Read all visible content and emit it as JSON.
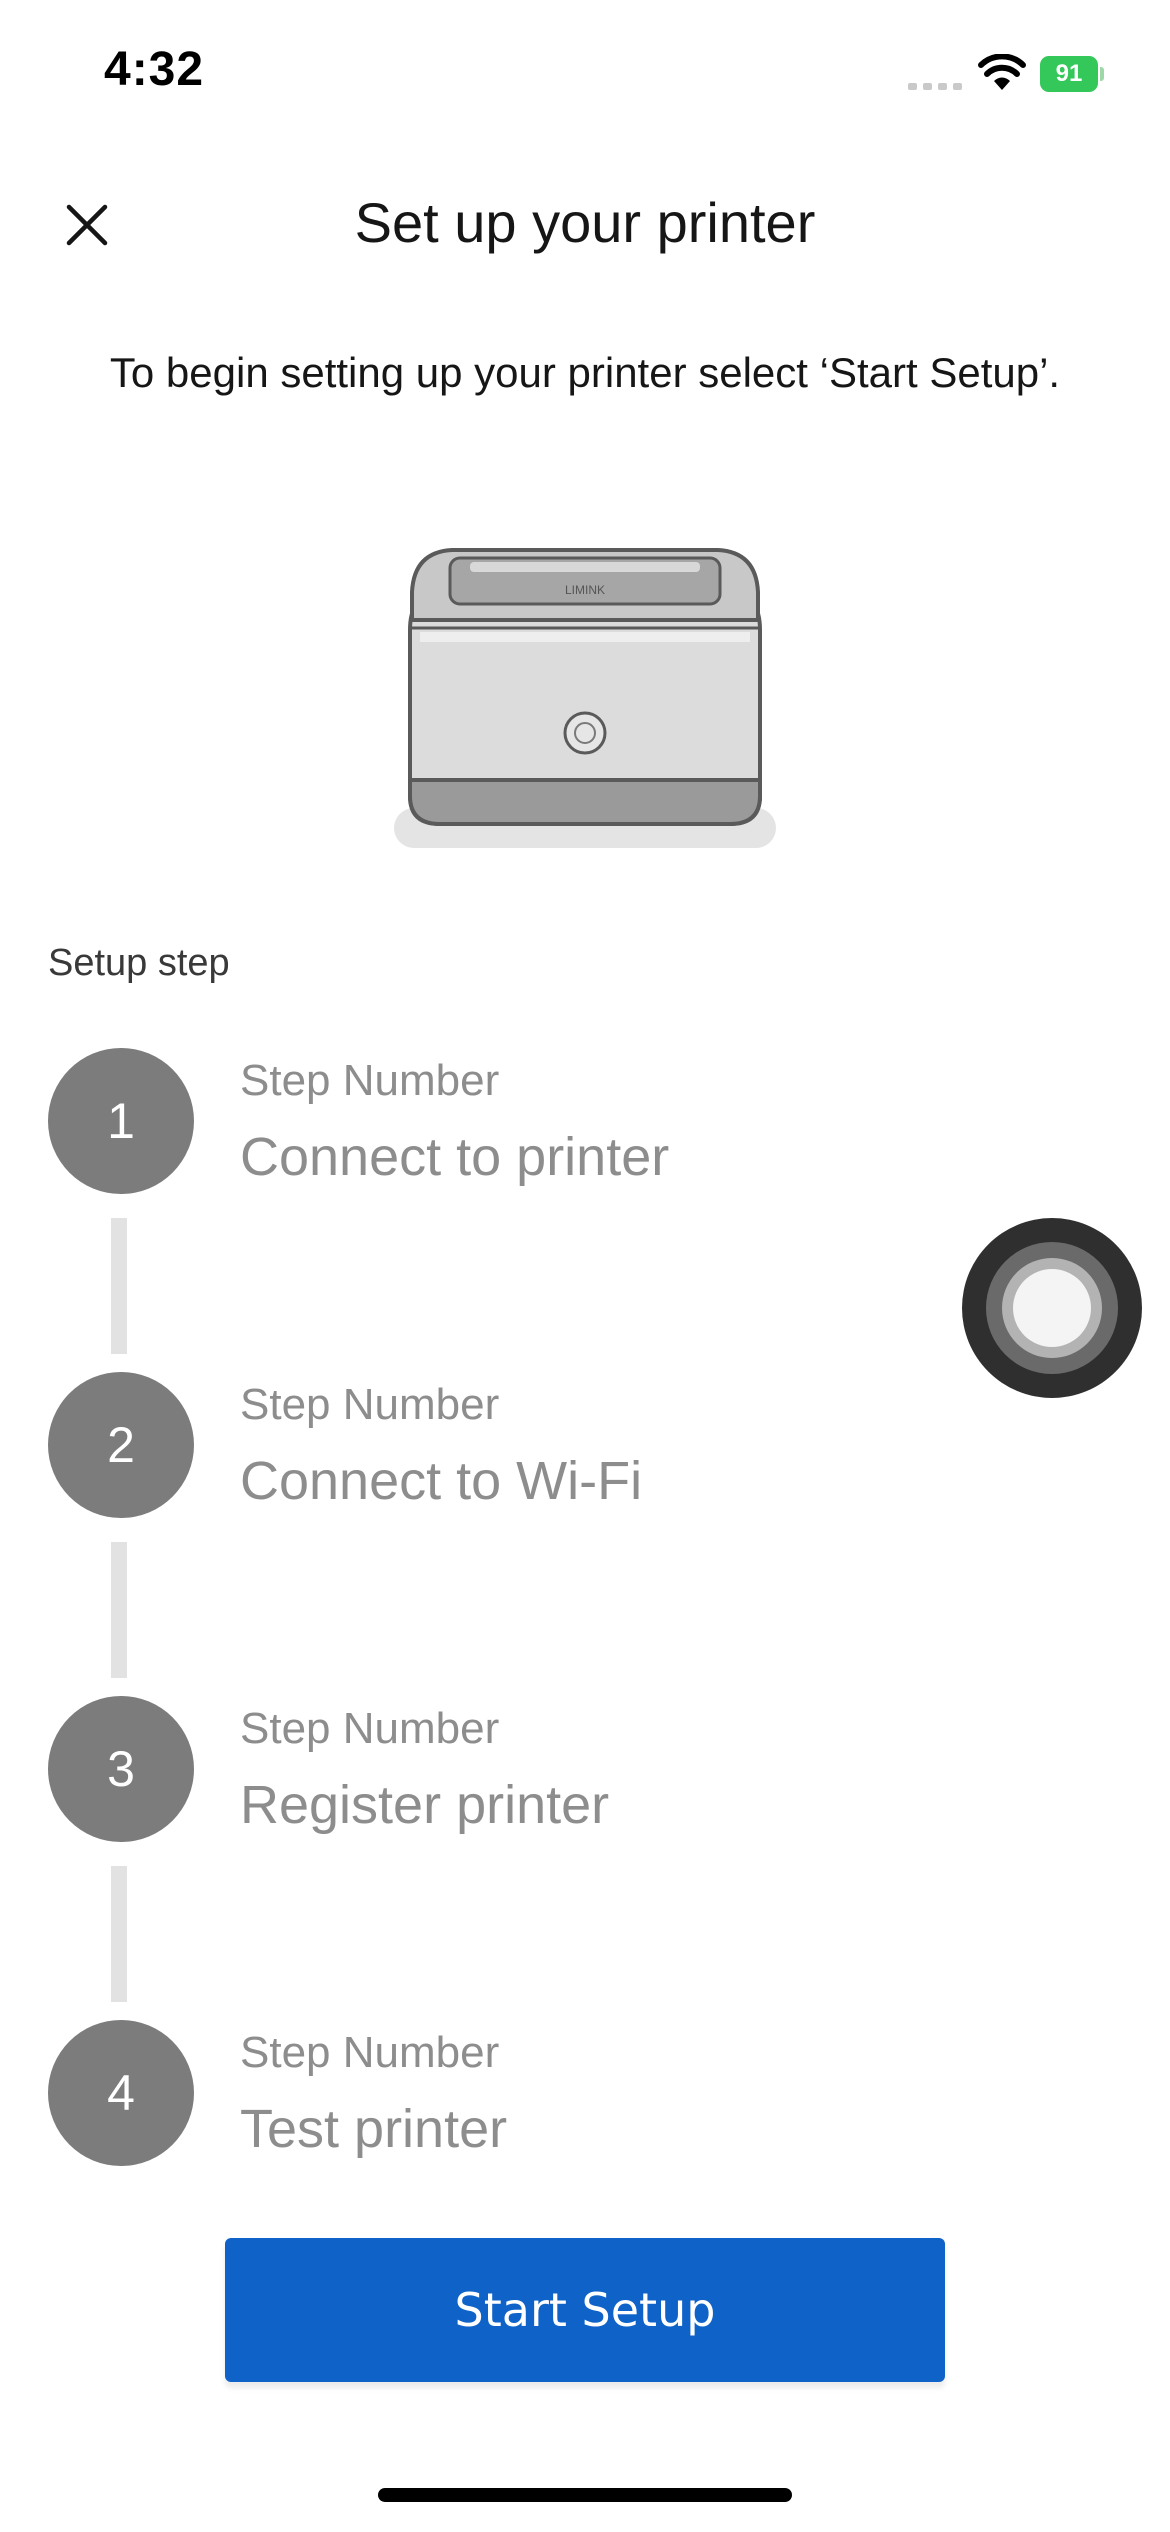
{
  "status_bar": {
    "time": "4:32",
    "battery_level": "91",
    "battery_color": "#34c759"
  },
  "header": {
    "title": "Set up your printer",
    "close_icon": "close-icon"
  },
  "intro": {
    "text": "To begin setting up your printer select ‘Start Setup’."
  },
  "illustration": {
    "icon": "printer-illustration",
    "brand_mark": "LIMINK"
  },
  "setup": {
    "section_label": "Setup step",
    "steps": [
      {
        "number": "1",
        "caption": "Step Number",
        "title": "Connect to printer"
      },
      {
        "number": "2",
        "caption": "Step Number",
        "title": "Connect to Wi-Fi"
      },
      {
        "number": "3",
        "caption": "Step Number",
        "title": "Register printer"
      },
      {
        "number": "4",
        "caption": "Step Number",
        "title": "Test printer"
      }
    ]
  },
  "actions": {
    "start_label": "Start Setup",
    "accent_color": "#0f62c8"
  }
}
